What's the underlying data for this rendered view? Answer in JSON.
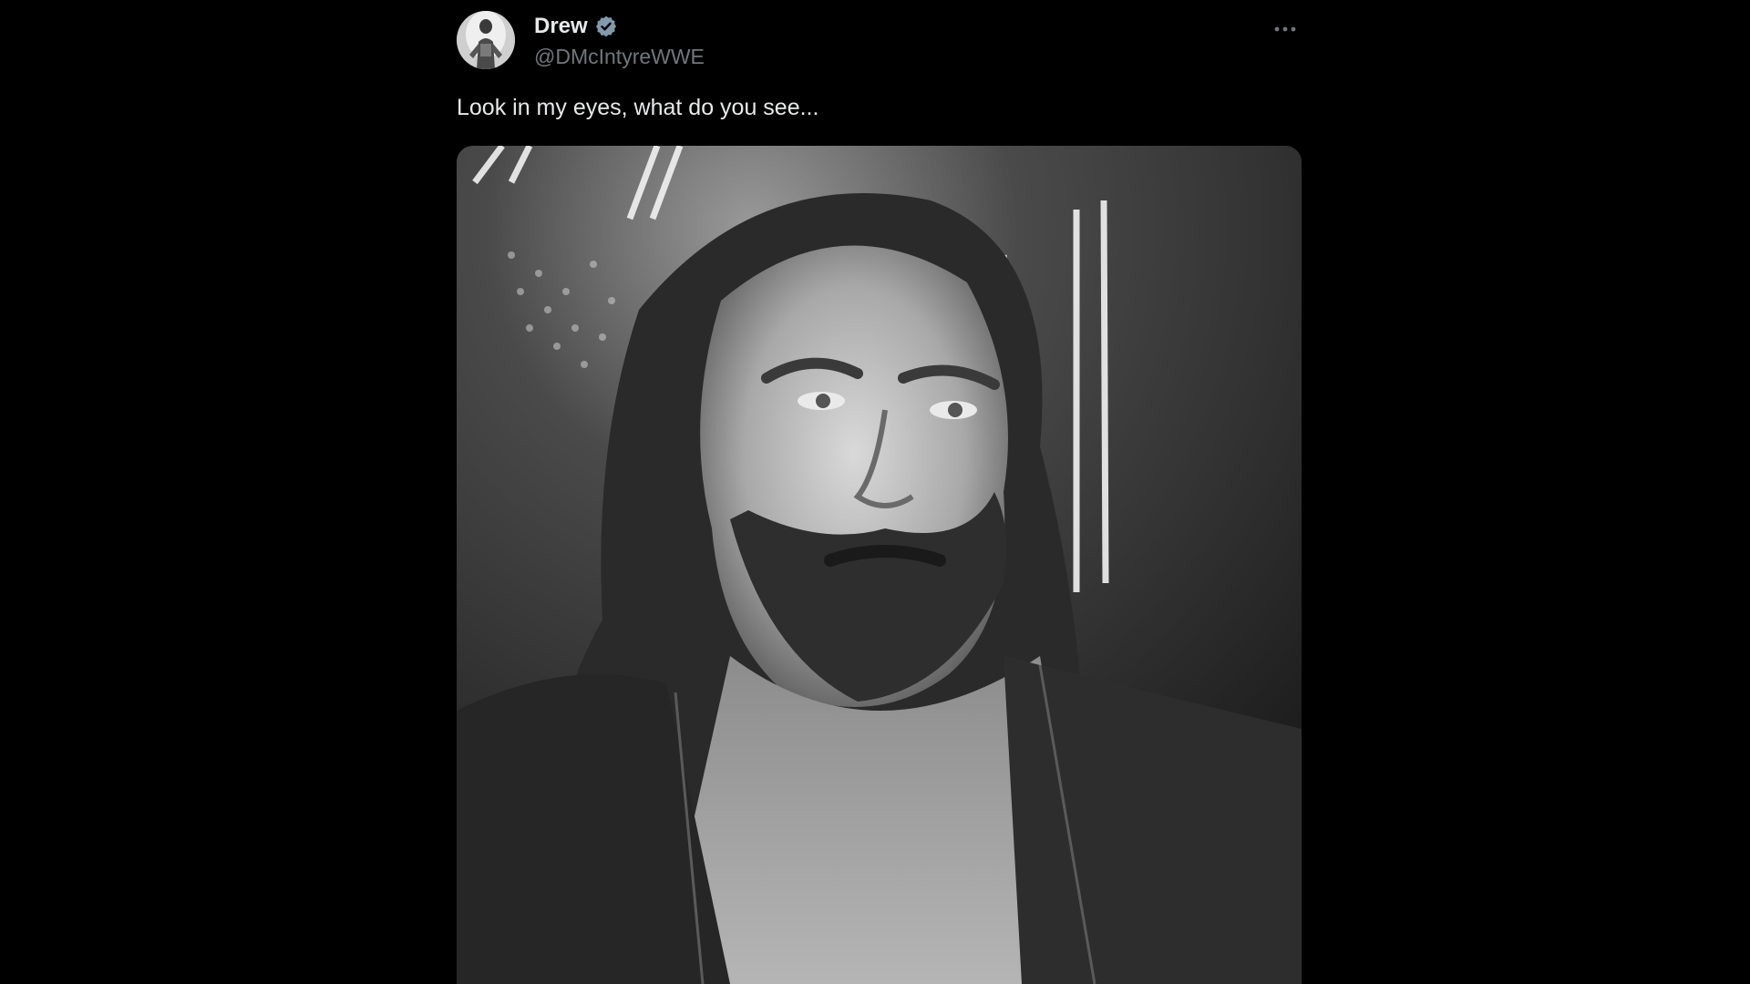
{
  "tweet": {
    "author": {
      "display_name": "Drew",
      "handle": "@DMcIntyreWWE",
      "verified_icon": "verified-badge-icon",
      "avatar_icon": "avatar"
    },
    "more_icon": "more-horizontal-icon",
    "text": "Look in my eyes, what do you see...",
    "media": {
      "type": "photo",
      "alt": ""
    }
  },
  "colors": {
    "background": "#000000",
    "primary_text": "#e7e9ea",
    "secondary_text": "#71767b",
    "verified_badge": "#829aab"
  }
}
